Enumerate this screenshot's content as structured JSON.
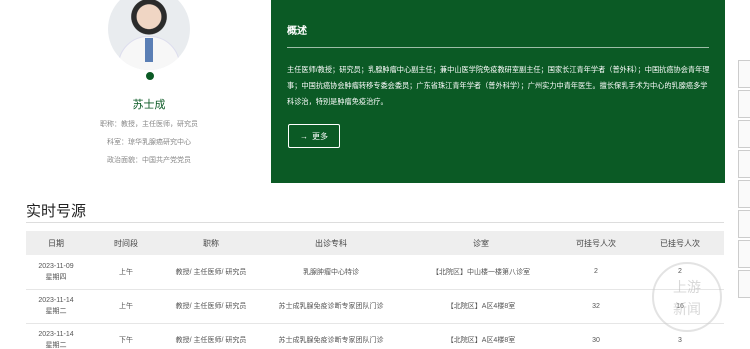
{
  "profile": {
    "name": "苏士成",
    "title_line": "职称：教授，主任医师，研究员",
    "dept_line": "科室：琼华乳腺癌研究中心",
    "party_line": "政治面貌：中国共产党党员"
  },
  "overview": {
    "heading": "概述",
    "text": "主任医师/教授；研究员；乳腺肿瘤中心副主任；兼中山医学院免疫教研室副主任；国家长江青年学者（普外科）；中国抗癌协会青年理事；中国抗癌协会肿瘤转移专委会委员；广东省珠江青年学者（普外科学）；广州实力中青年医生。擅长保乳手术为中心的乳腺癌多学科诊治，特别是肿瘤免疫治疗。",
    "more_label": "更多",
    "more_icon": "arrow-right-icon"
  },
  "schedule": {
    "title": "实时号源",
    "headers": [
      "日期",
      "时间段",
      "职称",
      "出诊专科",
      "诊室",
      "可挂号人次",
      "已挂号人次"
    ],
    "rows": [
      {
        "date": "2023-11-09",
        "weekday": "星期四",
        "period": "上午",
        "rank": "教授/ 主任医师/ 研究员",
        "specialty": "乳腺肿瘤中心特诊",
        "room": "【北院区】中山楼一楼第八诊室",
        "available": "2",
        "booked": "2"
      },
      {
        "date": "2023-11-14",
        "weekday": "星期二",
        "period": "上午",
        "rank": "教授/ 主任医师/ 研究员",
        "specialty": "苏士成乳腺免疫诊断专家团队门诊",
        "room": "【北院区】A区4楼8室",
        "available": "32",
        "booked": "16"
      },
      {
        "date": "2023-11-14",
        "weekday": "星期二",
        "period": "下午",
        "rank": "教授/ 主任医师/ 研究员",
        "specialty": "苏士成乳腺免疫诊断专家团队门诊",
        "room": "【北院区】A区4楼8室",
        "available": "30",
        "booked": "3"
      }
    ]
  },
  "watermark": {
    "line1": "上游",
    "line2": "新闻"
  },
  "colors": {
    "brand_green": "#0b5a25"
  }
}
